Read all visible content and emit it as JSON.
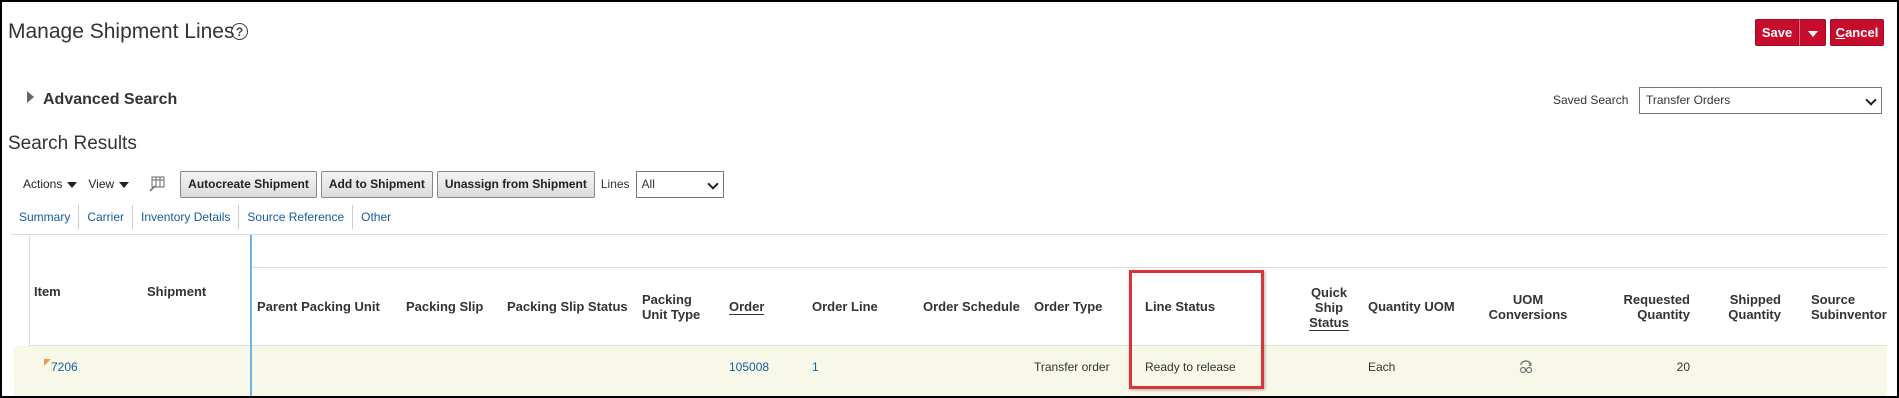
{
  "header": {
    "title": "Manage Shipment Lines",
    "help_icon": "question-circle-icon",
    "save_label": "Save",
    "cancel_label": "Cancel"
  },
  "colors": {
    "accent_red": "#c70d2e",
    "link_blue": "#145c9e",
    "highlight": "#d9333b",
    "frozen_divider": "#6cb6e4"
  },
  "advanced_search": {
    "label": "Advanced Search",
    "expanded": false
  },
  "saved_search": {
    "label": "Saved Search",
    "value": "Transfer Orders"
  },
  "results": {
    "title": "Search Results",
    "toolbar": {
      "actions_label": "Actions",
      "view_label": "View",
      "detach_icon": "detach-table-icon",
      "autocreate_label": "Autocreate Shipment",
      "add_label": "Add to Shipment",
      "unassign_label": "Unassign from Shipment",
      "lines_label": "Lines",
      "lines_value": "All"
    },
    "tabs": [
      "Summary",
      "Carrier",
      "Inventory Details",
      "Source Reference",
      "Other"
    ],
    "columns": {
      "item": "Item",
      "shipment": "Shipment",
      "parent_packing_unit": "Parent Packing Unit",
      "packing_slip": "Packing Slip",
      "packing_slip_status": "Packing Slip Status",
      "packing_unit_type_1": "Packing",
      "packing_unit_type_2": "Unit Type",
      "order": "Order",
      "order_line": "Order Line",
      "order_schedule": "Order Schedule",
      "order_type": "Order Type",
      "line_status": "Line Status",
      "quick_ship_status_1": "Quick",
      "quick_ship_status_2": "Ship",
      "quick_ship_status_3": "Status",
      "quantity_uom": "Quantity UOM",
      "uom_conversions_1": "UOM",
      "uom_conversions_2": "Conversions",
      "requested_quantity_1": "Requested",
      "requested_quantity_2": "Quantity",
      "shipped_quantity_1": "Shipped",
      "shipped_quantity_2": "Quantity",
      "source_subinventory_1": "Source",
      "source_subinventory_2": "Subinventor"
    },
    "rows": [
      {
        "item": "7206",
        "order": "105008",
        "order_line": "1",
        "order_type": "Transfer order",
        "line_status": "Ready to release",
        "quantity_uom": "Each",
        "uom_conversions_icon": "uom-conversion-icon",
        "requested_quantity": "20"
      }
    ]
  }
}
